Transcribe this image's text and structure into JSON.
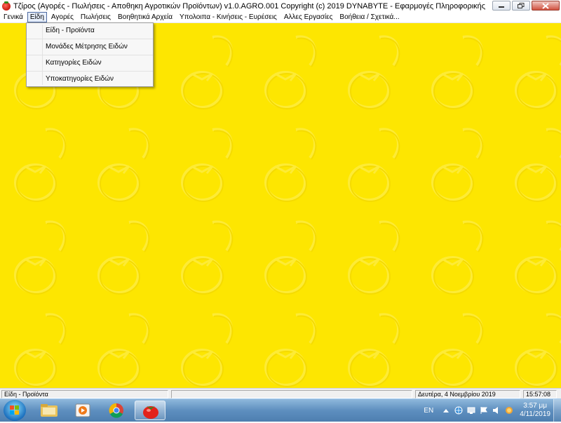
{
  "window": {
    "title": "Τζίρος (Αγορές - Πωλήσεις - Αποθηκη Αγροτικών Προϊόντων)  v1.0.AGRO.001   Copyright (c) 2019  DYNABYTE - Εφαρμογές Πληροφορικής"
  },
  "menubar": {
    "items": [
      {
        "label": "Γενικά"
      },
      {
        "label": "Είδη"
      },
      {
        "label": "Αγορές"
      },
      {
        "label": "Πωλήσεις"
      },
      {
        "label": "Βοηθητικά Αρχεία"
      },
      {
        "label": "Υπολοιπα - Κινήσεις - Ευρέσεις"
      },
      {
        "label": "Αλλες Εργασίες"
      },
      {
        "label": "Βοήθεια / Σχετικά..."
      }
    ],
    "active_index": 1
  },
  "dropdown": {
    "items": [
      {
        "label": "Είδη - Προϊόντα"
      },
      {
        "label": "Μονάδες Μέτρησης Ειδών"
      },
      {
        "label": "Κατηγορίες Ειδών"
      },
      {
        "label": "Υποκατηγορίες Ειδών"
      }
    ]
  },
  "statusbar": {
    "hint": "Είδη - Προϊόντα",
    "middle": "",
    "date": "Δευτέρα, 4 Νοεμβρίου 2019",
    "time": "15:57:08"
  },
  "taskbar": {
    "language": "EN",
    "clock_time": "3:57 μμ",
    "clock_date": "4/11/2019"
  },
  "colors": {
    "desktop": "#fde601",
    "taskbar": "#5e8fbf",
    "menu_highlight": "#e6eefb"
  }
}
